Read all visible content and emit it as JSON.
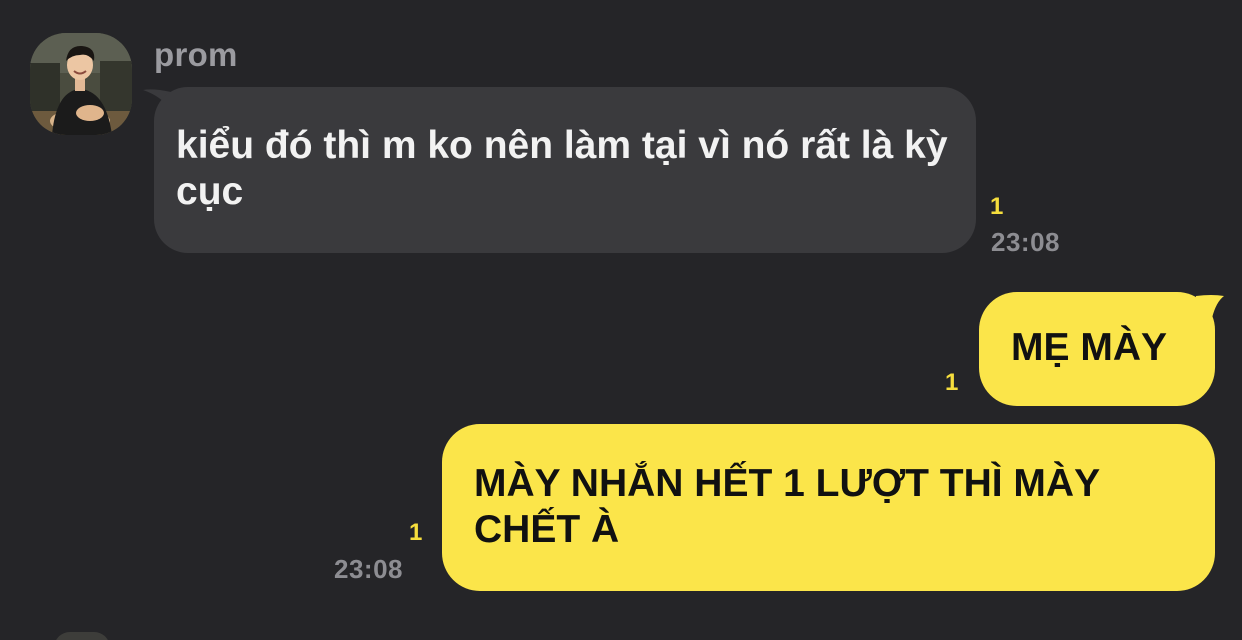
{
  "conversation": {
    "sender_name": "prom",
    "messages": [
      {
        "direction": "incoming",
        "text": "kiểu đó thì m ko nên làm tại vì nó rất là kỳ cục",
        "unread_count": "1",
        "time": "23:08"
      },
      {
        "direction": "outgoing",
        "text": "MẸ MÀY",
        "unread_count": "1",
        "time": ""
      },
      {
        "direction": "outgoing",
        "text": "MÀY NHẮN HẾT 1 LƯỢT THÌ MÀY CHẾT À",
        "unread_count": "1",
        "time": "23:08"
      }
    ]
  },
  "colors": {
    "background": "#252528",
    "incoming_bubble": "#3a3a3d",
    "outgoing_bubble": "#fbe54a",
    "unread_badge": "#f6de3d",
    "name_text": "#9b9ba0",
    "time_text": "#8d8d92"
  }
}
